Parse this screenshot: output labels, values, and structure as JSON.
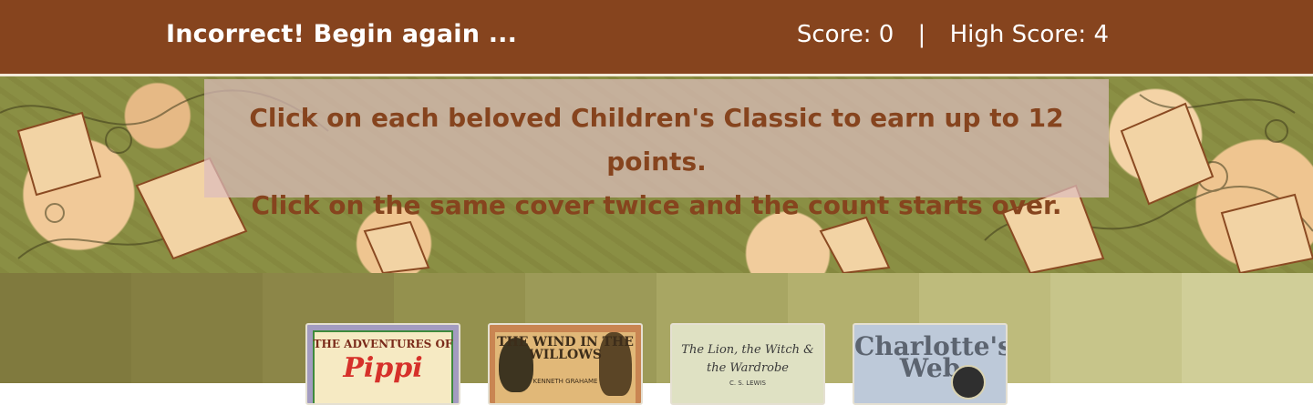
{
  "header": {
    "status_message": "Incorrect! Begin again ...",
    "score_label": "Score:",
    "score_value": "0",
    "separator": "|",
    "high_score_label": "High Score:",
    "high_score_value": "4"
  },
  "instructions": {
    "line1": "Click on each beloved Children's Classic to earn up to 12 points.",
    "line2": "Click on the same cover twice and the count starts over."
  },
  "colors": {
    "header_bg": "#86441e",
    "accent_text": "#86441e",
    "stripes": [
      "#807a3e",
      "#857f42",
      "#8c8648",
      "#94914e",
      "#9c9a58",
      "#a8a663",
      "#b3b06e",
      "#bebb7c",
      "#c7c58a",
      "#d0ce98"
    ]
  },
  "cards": [
    {
      "title_line": "THE ADVENTURES OF",
      "big": "Pippi",
      "icon": "book-cover-pippi"
    },
    {
      "title_line": "THE WIND IN THE WILLOWS",
      "sub": "KENNETH GRAHAME",
      "icon": "book-cover-wind-willows"
    },
    {
      "title_line": "The Lion, the Witch & the Wardrobe",
      "sub": "C. S. LEWIS",
      "icon": "book-cover-lion-witch"
    },
    {
      "title_line": "Charlotte's Web",
      "icon": "book-cover-charlottes-web"
    }
  ]
}
